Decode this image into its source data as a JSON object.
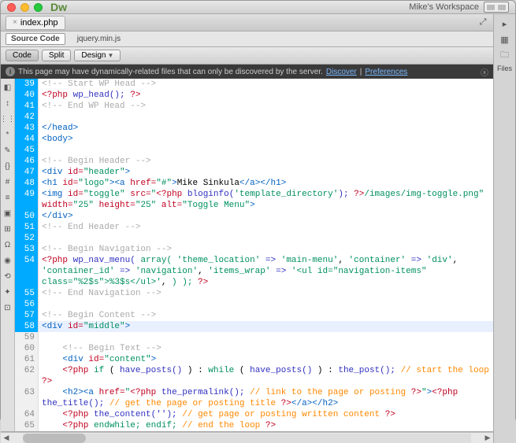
{
  "titlebar": {
    "app": "Dw",
    "workspace": "Mike's Workspace"
  },
  "filetab": {
    "name": "index.php",
    "close": "×"
  },
  "subtabs": {
    "source": "Source Code",
    "related": "jquery.min.js"
  },
  "viewbar": {
    "code": "Code",
    "split": "Split",
    "design": "Design"
  },
  "infobar": {
    "text": "This page may have dynamically-related files that can only be discovered by the server.",
    "discover": "Discover",
    "sep": " | ",
    "prefs": "Preferences"
  },
  "right": {
    "files": "Files"
  },
  "lines": [
    {
      "n": "39",
      "hl": true,
      "html": "<span class='c-comment'>&lt;!-- Start WP Head --&gt;</span>"
    },
    {
      "n": "40",
      "hl": true,
      "html": "<span class='c-php'>&lt;?php</span> <span class='c-func'>wp_head();</span> <span class='c-php'>?&gt;</span>"
    },
    {
      "n": "41",
      "hl": true,
      "html": "<span class='c-comment'>&lt;!-- End WP Head --&gt;</span>"
    },
    {
      "n": "42",
      "hl": true,
      "html": ""
    },
    {
      "n": "43",
      "hl": true,
      "html": "<span class='c-tag'>&lt;/head&gt;</span>"
    },
    {
      "n": "44",
      "hl": true,
      "html": "<span class='c-tag'>&lt;body&gt;</span>"
    },
    {
      "n": "45",
      "hl": true,
      "html": ""
    },
    {
      "n": "46",
      "hl": true,
      "html": "<span class='c-comment'>&lt;!-- Begin Header --&gt;</span>"
    },
    {
      "n": "47",
      "hl": true,
      "html": "<span class='c-tag'>&lt;div</span> <span class='c-attr'>id=</span><span class='c-val'>\"header\"</span><span class='c-tag'>&gt;</span>"
    },
    {
      "n": "48",
      "hl": true,
      "html": "<span class='c-tag'>&lt;h1</span> <span class='c-attr'>id=</span><span class='c-val'>\"logo\"</span><span class='c-tag'>&gt;&lt;a</span> <span class='c-attr'>href=</span><span class='c-val'>\"#\"</span><span class='c-tag'>&gt;</span>Mike Sinkula<span class='c-tag'>&lt;/a&gt;&lt;/h1&gt;</span>"
    },
    {
      "n": "49",
      "hl": true,
      "html": "<span class='c-tag'>&lt;img</span> <span class='c-attr'>id=</span><span class='c-val'>\"toggle\"</span> <span class='c-attr'>src=</span><span class='c-val'>\"</span><span class='c-php'>&lt;?php</span> <span class='c-func'>bloginfo(</span><span class='c-string'>'template_directory'</span><span class='c-func'>);</span> <span class='c-php'>?&gt;</span><span class='c-val'>/images/img-toggle.png\"</span>"
    },
    {
      "n": "",
      "hl": true,
      "html": "<span class='c-attr'>width=</span><span class='c-val'>\"25\"</span> <span class='c-attr'>height=</span><span class='c-val'>\"25\"</span> <span class='c-attr'>alt=</span><span class='c-val'>\"Toggle Menu\"</span><span class='c-tag'>&gt;</span>"
    },
    {
      "n": "50",
      "hl": true,
      "html": "<span class='c-tag'>&lt;/div&gt;</span>"
    },
    {
      "n": "51",
      "hl": true,
      "html": "<span class='c-comment'>&lt;!-- End Header --&gt;</span>"
    },
    {
      "n": "52",
      "hl": true,
      "html": ""
    },
    {
      "n": "53",
      "hl": true,
      "html": "<span class='c-comment'>&lt;!-- Begin Navigation --&gt;</span>"
    },
    {
      "n": "54",
      "hl": true,
      "html": "<span class='c-php'>&lt;?php</span> <span class='c-func'>wp_nav_menu(</span> <span class='c-phpkw'>array(</span> <span class='c-string'>'theme_location'</span> <span class='c-func'>=&gt;</span> <span class='c-string'>'main-menu'</span>, <span class='c-string'>'container'</span> <span class='c-func'>=&gt;</span> <span class='c-string'>'div'</span>,"
    },
    {
      "n": "",
      "hl": true,
      "html": "<span class='c-string'>'container_id'</span> <span class='c-func'>=&gt;</span> <span class='c-string'>'navigation'</span>, <span class='c-string'>'items_wrap'</span> <span class='c-func'>=&gt;</span> <span class='c-string'>'&lt;ul id=\"navigation-items\"</span>"
    },
    {
      "n": "",
      "hl": true,
      "html": "<span class='c-string'>class=\"%2$s\"&gt;%3$s&lt;/ul&gt;'</span>, <span class='c-phpkw'>) );</span> <span class='c-php'>?&gt;</span>"
    },
    {
      "n": "55",
      "hl": true,
      "html": "<span class='c-comment'>&lt;!-- End Navigation --&gt;</span>"
    },
    {
      "n": "56",
      "hl": true,
      "html": ""
    },
    {
      "n": "57",
      "hl": true,
      "html": "<span class='c-comment'>&lt;!-- Begin Content --&gt;</span>"
    },
    {
      "n": "58",
      "hl": true,
      "hlline": true,
      "html": "<span class='c-tag'>&lt;div</span> <span class='c-attr'>id=</span><span class='c-val'>\"middle\"</span><span class='c-tag'>&gt;</span>"
    },
    {
      "n": "59",
      "html": ""
    },
    {
      "n": "60",
      "html": "    <span class='c-comment'>&lt;!-- Begin Text --&gt;</span>"
    },
    {
      "n": "61",
      "html": "    <span class='c-tag'>&lt;div</span> <span class='c-attr'>id=</span><span class='c-val'>\"content\"</span><span class='c-tag'>&gt;</span>"
    },
    {
      "n": "62",
      "html": "    <span class='c-php'>&lt;?php</span> <span class='c-phpkw'>if</span> ( <span class='c-func'>have_posts()</span> ) : <span class='c-phpkw'>while</span> ( <span class='c-func'>have_posts()</span> ) : <span class='c-func'>the_post();</span> <span class='c-phpcomment'>// start the loop</span>"
    },
    {
      "n": "",
      "html": "<span class='c-php'>?&gt;</span>"
    },
    {
      "n": "63",
      "html": "    <span class='c-tag'>&lt;h2&gt;&lt;a</span> <span class='c-attr'>href=</span><span class='c-val'>\"</span><span class='c-php'>&lt;?php</span> <span class='c-func'>the_permalink();</span> <span class='c-phpcomment'>// link to the page or posting</span> <span class='c-php'>?&gt;</span><span class='c-val'>\"</span><span class='c-tag'>&gt;</span><span class='c-php'>&lt;?php</span>"
    },
    {
      "n": "",
      "html": "<span class='c-func'>the_title();</span> <span class='c-phpcomment'>// get the page or posting title</span> <span class='c-php'>?&gt;</span><span class='c-tag'>&lt;/a&gt;&lt;/h2&gt;</span>"
    },
    {
      "n": "64",
      "html": "    <span class='c-php'>&lt;?php</span> <span class='c-func'>the_content('');</span> <span class='c-phpcomment'>// get page or posting written content</span> <span class='c-php'>?&gt;</span>"
    },
    {
      "n": "65",
      "html": "    <span class='c-php'>&lt;?php</span> <span class='c-phpkw'>endwhile; endif;</span> <span class='c-phpcomment'>// end the loop</span> <span class='c-php'>?&gt;</span>"
    }
  ]
}
